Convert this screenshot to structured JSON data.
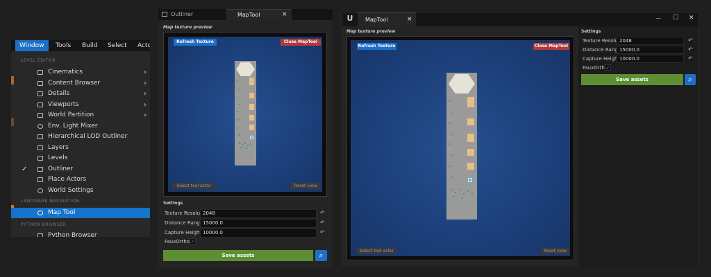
{
  "menu": {
    "menubar": [
      "Window",
      "Tools",
      "Build",
      "Select",
      "Actor"
    ],
    "sections": [
      "LEVEL EDITOR",
      "LANDMARK NAVIGATION",
      "PYTHON BROWSER"
    ],
    "items": [
      {
        "label": "Cinematics",
        "submenu": true
      },
      {
        "label": "Content Browser",
        "submenu": true
      },
      {
        "label": "Details",
        "submenu": true
      },
      {
        "label": "Viewports",
        "submenu": true
      },
      {
        "label": "World Partition",
        "submenu": true
      },
      {
        "label": "Env. Light Mixer"
      },
      {
        "label": "Hierarchical LOD Outliner"
      },
      {
        "label": "Layers"
      },
      {
        "label": "Levels"
      },
      {
        "label": "Outliner",
        "checked": true
      },
      {
        "label": "Place Actors"
      },
      {
        "label": "World Settings"
      }
    ],
    "landmark_item": "Map Tool",
    "python_item": "Python Browser",
    "check_glyph": "✓",
    "arrow_glyph": "›"
  },
  "panel_small": {
    "tabs": [
      "Outliner",
      "MapTool"
    ],
    "close_glyph": "×"
  },
  "panel_large": {
    "tab": "MapTool",
    "close_glyph": "×",
    "window_controls": [
      "—",
      "☐",
      "✕"
    ]
  },
  "maptool": {
    "section_preview": "Map texture preview",
    "refresh_button": "Refresh Texture",
    "close_button": "Close MapTool",
    "select_button": "Select tool actor",
    "reset_button": "Reset view",
    "settings_title": "Settings",
    "settings": [
      {
        "label": "Texture Resolution",
        "value": "2048"
      },
      {
        "label": "Distance Range",
        "value": "15000.0"
      },
      {
        "label": "Capture Height",
        "value": "10000.0"
      }
    ],
    "faux_label": "FauxOrtho",
    "faux_checked": true,
    "save_button": "Save assets",
    "reset_glyph": "↶",
    "search_glyph": "⌕",
    "check_glyph": "✓"
  },
  "colors": {
    "accent_blue": "#1e6fc8",
    "close_red": "#b23a3a",
    "save_green": "#5d8e34",
    "map_blue": "#1c3f7a"
  }
}
